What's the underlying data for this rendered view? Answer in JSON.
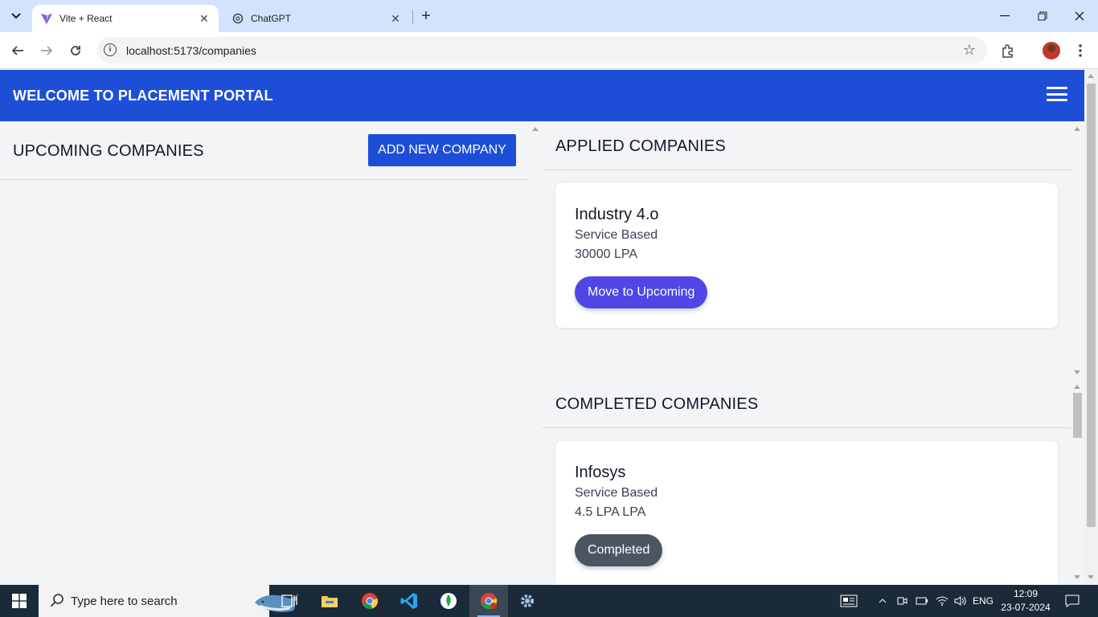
{
  "browser": {
    "tabs": [
      {
        "title": "Vite + React",
        "active": true
      },
      {
        "title": "ChatGPT",
        "active": false
      }
    ],
    "url": "localhost:5173/companies"
  },
  "app": {
    "title": "WELCOME TO PLACEMENT PORTAL",
    "upcoming": {
      "heading": "UPCOMING COMPANIES",
      "add_button": "ADD NEW COMPANY"
    },
    "applied": {
      "heading": "APPLIED COMPANIES",
      "companies": [
        {
          "name": "Industry 4.o",
          "type": "Service Based",
          "salary": "30000 LPA",
          "action": "Move to Upcoming"
        }
      ]
    },
    "completed": {
      "heading": "COMPLETED COMPANIES",
      "companies": [
        {
          "name": "Infosys",
          "type": "Service Based",
          "salary": "4.5 LPA LPA",
          "action": "Completed"
        }
      ]
    }
  },
  "taskbar": {
    "search_placeholder": "Type here to search",
    "language": "ENG",
    "time": "12:09",
    "date": "23-07-2024"
  },
  "colors": {
    "primary": "#1d4ed8",
    "move_button": "#4f46e5",
    "completed_button": "#4b5563"
  }
}
